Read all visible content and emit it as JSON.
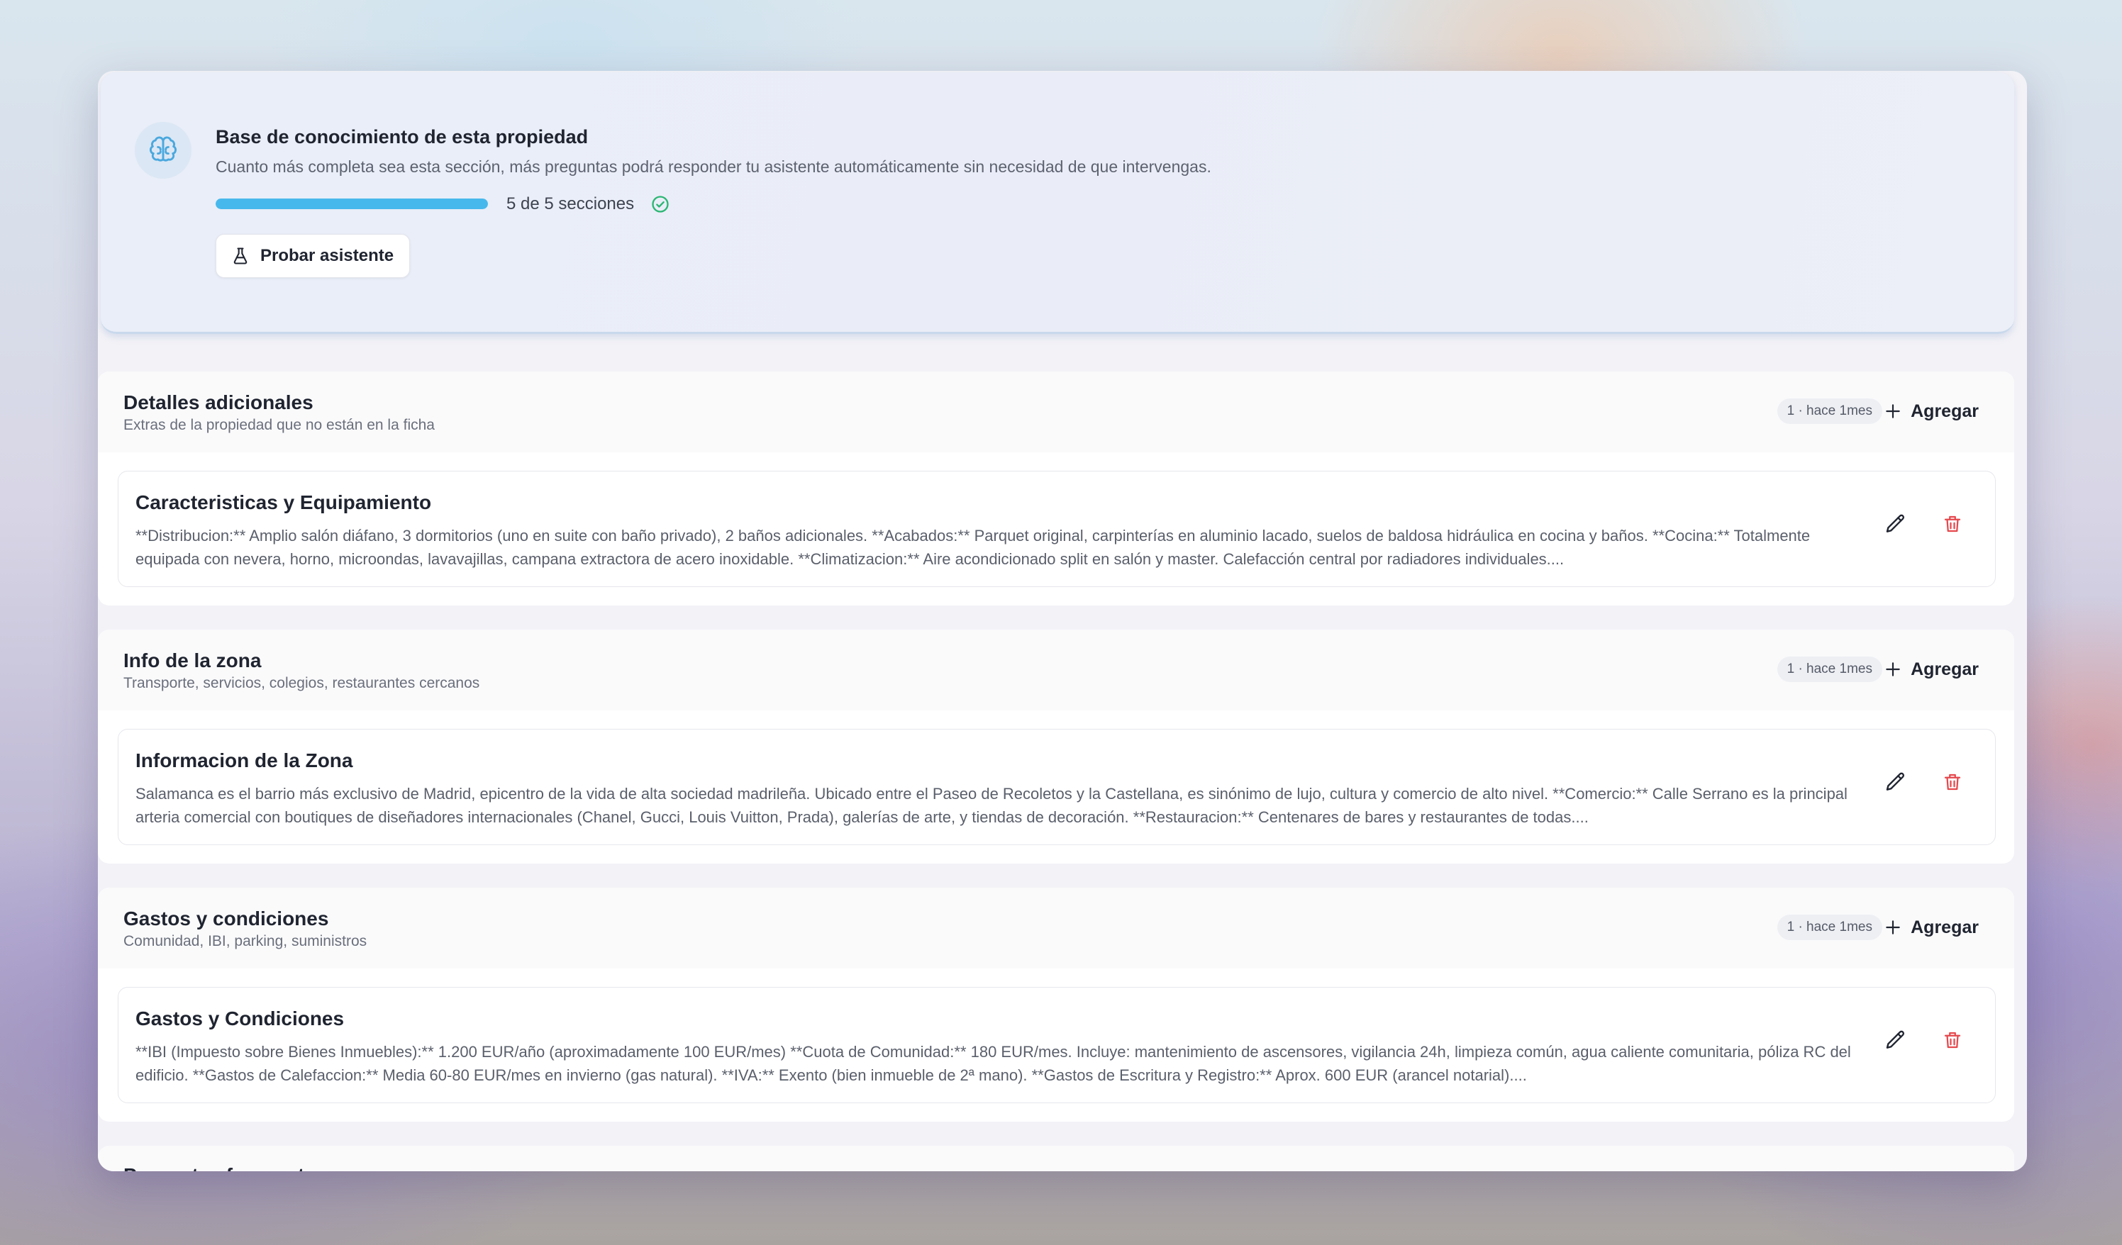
{
  "knowledge_base": {
    "title": "Base de conocimiento de esta propiedad",
    "description": "Cuanto más completa sea esta sección, más preguntas podrá responder tu asistente automáticamente sin necesidad de que intervengas.",
    "progress_fraction": 1.0,
    "progress_text": "5 de 5 secciones",
    "test_button_label": "Probar asistente",
    "icon": "brain-icon"
  },
  "add_label": "Agregar",
  "colors": {
    "accent": "#47b8ec",
    "success": "#2bb673",
    "danger": "#e5484d"
  },
  "sections": [
    {
      "title": "Detalles adicionales",
      "subtitle": "Extras de la propiedad que no están en la ficha",
      "badge": "1 · hace 1mes",
      "entry": {
        "title": "Caracteristicas y Equipamiento",
        "text": "**Distribucion:** Amplio salón diáfano, 3 dormitorios (uno en suite con baño privado), 2 baños adicionales. **Acabados:** Parquet original, carpinterías en aluminio lacado, suelos de baldosa hidráulica en cocina y baños. **Cocina:** Totalmente equipada con nevera, horno, microondas, lavavajillas, campana extractora de acero inoxidable. **Climatizacion:** Aire acondicionado split en salón y master. Calefacción central por radiadores individuales...."
      }
    },
    {
      "title": "Info de la zona",
      "subtitle": "Transporte, servicios, colegios, restaurantes cercanos",
      "badge": "1 · hace 1mes",
      "entry": {
        "title": "Informacion de la Zona",
        "text": "Salamanca es el barrio más exclusivo de Madrid, epicentro de la vida de alta sociedad madrileña. Ubicado entre el Paseo de Recoletos y la Castellana, es sinónimo de lujo, cultura y comercio de alto nivel. **Comercio:** Calle Serrano es la principal arteria comercial con boutiques de diseñadores internacionales (Chanel, Gucci, Louis Vuitton, Prada), galerías de arte, y tiendas de decoración. **Restauracion:** Centenares de bares y restaurantes de todas...."
      }
    },
    {
      "title": "Gastos y condiciones",
      "subtitle": "Comunidad, IBI, parking, suministros",
      "badge": "1 · hace 1mes",
      "entry": {
        "title": "Gastos y Condiciones",
        "text": "**IBI (Impuesto sobre Bienes Inmuebles):** 1.200 EUR/año (aproximadamente 100 EUR/mes) **Cuota de Comunidad:** 180 EUR/mes. Incluye: mantenimiento de ascensores, vigilancia 24h, limpieza común, agua caliente comunitaria, póliza RC del edificio. **Gastos de Calefaccion:** Media 60-80 EUR/mes en invierno (gas natural). **IVA:** Exento (bien inmueble de 2ª mano). **Gastos de Escritura y Registro:** Aprox. 600 EUR (arancel notarial)...."
      }
    }
  ],
  "next_section_title": "Preguntas frecuentes"
}
